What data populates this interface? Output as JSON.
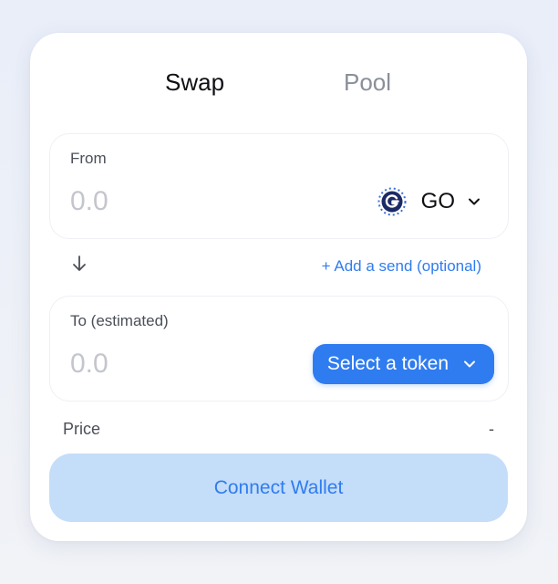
{
  "tabs": [
    {
      "label": "Swap",
      "active": true
    },
    {
      "label": "Pool",
      "active": false
    }
  ],
  "from": {
    "label": "From",
    "amount_placeholder": "0.0",
    "token": {
      "symbol": "GO",
      "icon": "gochain-logo-icon"
    }
  },
  "middle": {
    "arrow_icon": "arrow-down-icon",
    "add_send_label": "+ Add a send (optional)"
  },
  "to": {
    "label": "To (estimated)",
    "amount_placeholder": "0.0",
    "select_token_label": "Select a token"
  },
  "price": {
    "label": "Price",
    "value": "-"
  },
  "connect_wallet_label": "Connect Wallet",
  "colors": {
    "accent": "#2f7cf0",
    "connect_bg": "#c4ddf9",
    "text_primary": "#0f0f14",
    "text_muted": "#8a8f99",
    "placeholder": "#c3c6cc"
  }
}
